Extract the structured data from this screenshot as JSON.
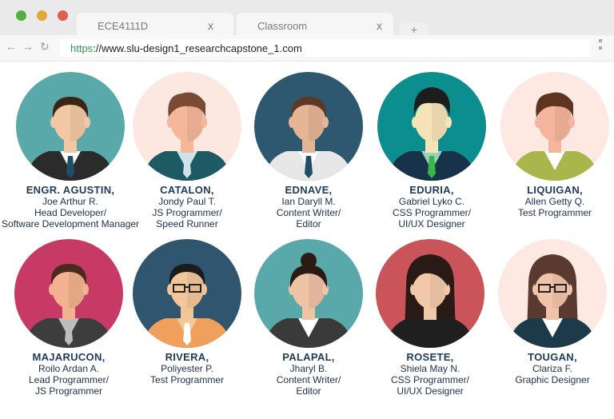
{
  "browser": {
    "tabs": [
      {
        "label": "ECE4111D",
        "close": "x"
      },
      {
        "label": "Classroom",
        "close": "x"
      }
    ],
    "new_tab": "+",
    "url_scheme": "https",
    "url_rest": "://www.slu-design1_researchcapstone_1.com"
  },
  "members": [
    {
      "surname": "ENGR. AGUSTIN,",
      "given": "Joe Arthur R.",
      "role1": "Head Developer/",
      "role2": "Software Development Manager",
      "bg": "#59a9aa",
      "skin": "#f2c8a4",
      "hair": "#3a2417",
      "outfit": "suit-dark",
      "hairstyle": "short"
    },
    {
      "surname": "CATALON,",
      "given": "Jondy Paul T.",
      "role1": "JS Programmer/",
      "role2": "Speed Runner",
      "bg": "#fce8e0",
      "skin": "#f5b79a",
      "hair": "#7b4a35",
      "outfit": "suit-teal",
      "hairstyle": "quiff"
    },
    {
      "surname": "EDNAVE,",
      "given": "Ian Daryll M.",
      "role1": "Content Writer/",
      "role2": "Editor",
      "bg": "#2e5870",
      "skin": "#e6b596",
      "hair": "#5a3a24",
      "outfit": "shirt-white",
      "hairstyle": "short"
    },
    {
      "surname": "EDURIA,",
      "given": "Gabriel Lyko C.",
      "role1": "CSS Programmer/",
      "role2": "UI/UX Designer",
      "bg": "#0d8e8e",
      "skin": "#f6e4b8",
      "hair": "#1d1d1d",
      "outfit": "suit-navy",
      "hairstyle": "tall"
    },
    {
      "surname": "LIQUIGAN,",
      "given": "Allen Getty Q.",
      "role1": "Test Programmer",
      "role2": "",
      "bg": "#fde8e2",
      "skin": "#f5b49c",
      "hair": "#5d3520",
      "outfit": "sweater-olive",
      "hairstyle": "quiff"
    },
    {
      "surname": "MAJARUCON,",
      "given": "Roilo Ardan A.",
      "role1": "Lead Programmer/",
      "role2": "JS Programmer",
      "bg": "#c73a66",
      "skin": "#f3b28f",
      "hair": "#4a2a1c",
      "outfit": "suit-grey",
      "hairstyle": "short"
    },
    {
      "surname": "RIVERA,",
      "given": "Poliyester P.",
      "role1": "Test Programmer",
      "role2": "",
      "bg": "#2f556f",
      "skin": "#f3c69a",
      "hair": "#1c1c1c",
      "outfit": "shirt-orange",
      "hairstyle": "nerd"
    },
    {
      "surname": "PALAPAL,",
      "given": "Jharyl B.",
      "role1": "Content Writer/",
      "role2": "Editor",
      "bg": "#59a9aa",
      "skin": "#efc3a6",
      "hair": "#2c1a14",
      "outfit": "suit-dark-f",
      "hairstyle": "bun"
    },
    {
      "surname": "ROSETE,",
      "given": "Shiela May N.",
      "role1": "CSS Programmer/",
      "role2": "UI/UX Designer",
      "bg": "#c9555a",
      "skin": "#f1c9a9",
      "hair": "#2a1a16",
      "outfit": "top-black",
      "hairstyle": "long"
    },
    {
      "surname": "TOUGAN,",
      "given": "Clariza F.",
      "role1": "Graphic Designer",
      "role2": "",
      "bg": "#fde8e2",
      "skin": "#f2c3ab",
      "hair": "#5a3a30",
      "outfit": "blazer-navy",
      "hairstyle": "long-glasses"
    }
  ]
}
